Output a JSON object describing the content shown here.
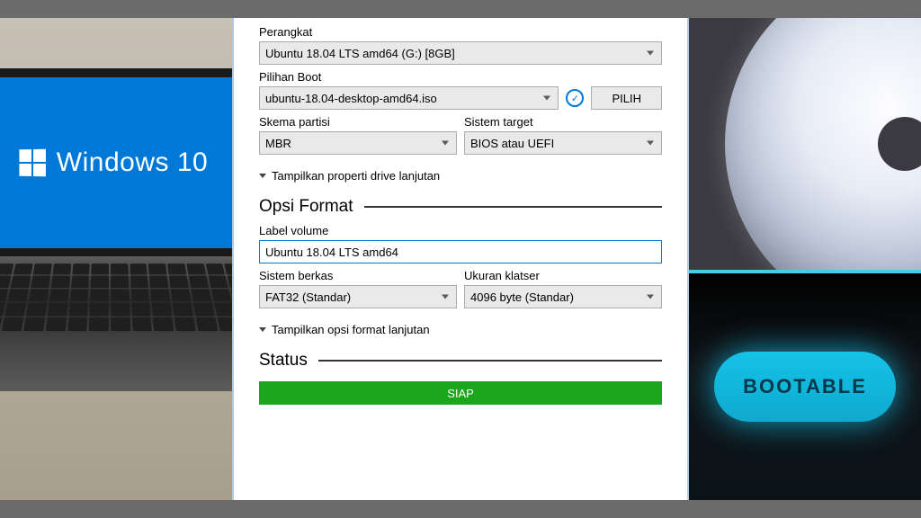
{
  "left": {
    "os_label": "Windows 10"
  },
  "rufus": {
    "device": {
      "label": "Perangkat",
      "value": "Ubuntu 18.04 LTS amd64 (G:) [8GB]"
    },
    "boot_selection": {
      "label": "Pilihan Boot",
      "value": "ubuntu-18.04-desktop-amd64.iso",
      "select_button": "PILIH"
    },
    "partition_scheme": {
      "label": "Skema partisi",
      "value": "MBR"
    },
    "target_system": {
      "label": "Sistem target",
      "value": "BIOS atau UEFI"
    },
    "advanced_drive_toggle": "Tampilkan properti drive lanjutan",
    "format_heading": "Opsi Format",
    "volume_label": {
      "label": "Label volume",
      "value": "Ubuntu 18.04 LTS amd64"
    },
    "filesystem": {
      "label": "Sistem berkas",
      "value": "FAT32 (Standar)"
    },
    "cluster_size": {
      "label": "Ukuran klatser",
      "value": "4096 byte (Standar)"
    },
    "advanced_format_toggle": "Tampilkan opsi format lanjutan",
    "status_heading": "Status",
    "status_value": "SIAP"
  },
  "right": {
    "badge": "BOOTABLE"
  }
}
